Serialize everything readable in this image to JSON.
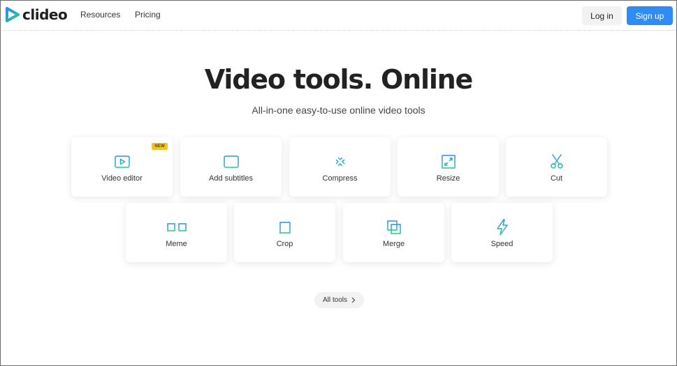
{
  "header": {
    "logo_text": "clideo",
    "nav": [
      {
        "label": "Resources"
      },
      {
        "label": "Pricing"
      }
    ],
    "login_label": "Log in",
    "signup_label": "Sign up"
  },
  "hero": {
    "title": "Video tools. Online",
    "subtitle": "All-in-one easy-to-use online video tools"
  },
  "tools": [
    {
      "label": "Video editor",
      "icon": "play-square-icon",
      "badge": "NEW"
    },
    {
      "label": "Add subtitles",
      "icon": "subtitles-icon"
    },
    {
      "label": "Compress",
      "icon": "compress-icon"
    },
    {
      "label": "Resize",
      "icon": "resize-icon"
    },
    {
      "label": "Cut",
      "icon": "scissors-icon"
    },
    {
      "label": "Meme",
      "icon": "glasses-icon"
    },
    {
      "label": "Crop",
      "icon": "crop-icon"
    },
    {
      "label": "Merge",
      "icon": "merge-icon"
    },
    {
      "label": "Speed",
      "icon": "lightning-icon"
    }
  ],
  "all_tools_label": "All tools",
  "colors": {
    "accent_blue": "#2f8cf5",
    "icon_gradient_start": "#2d8cf0",
    "icon_gradient_end": "#1fce8e",
    "badge_yellow": "#f9c21a"
  }
}
